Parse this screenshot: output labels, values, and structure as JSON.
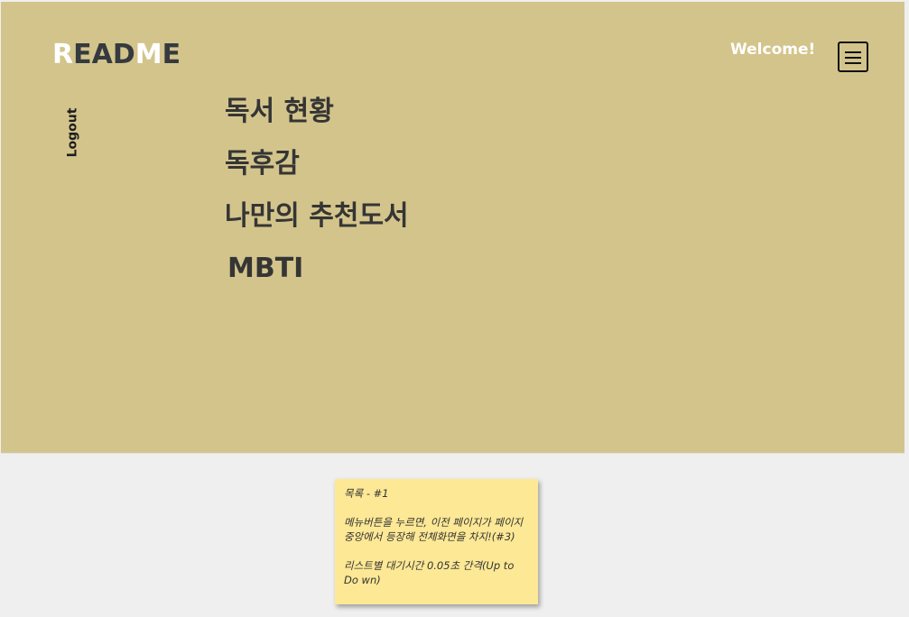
{
  "logo": {
    "r": "R",
    "ead": "EAD",
    "m": "M",
    "e": "E"
  },
  "header": {
    "welcome": "Welcome!",
    "logout": "Logout",
    "menu_icon": "hamburger-menu-icon"
  },
  "nav": {
    "items": [
      {
        "label": "독서 현황"
      },
      {
        "label": "독후감"
      },
      {
        "label": "나만의 추천도서"
      },
      {
        "label": "MBTI"
      }
    ]
  },
  "note": {
    "title": "목록 - #1",
    "line1": "메뉴버튼을 누르면, 이전 페이지가 페이지 중앙에서 등장해 전체화면을 차지!(#3)",
    "line2": "리스트별 대기시간 0.05초 간격(Up to Do wn)"
  },
  "colors": {
    "hero_bg": "#d3c48b",
    "note_bg": "#fde895",
    "page_bg": "#efefef",
    "text_dark": "#353535",
    "accent_white": "#ffffff"
  }
}
